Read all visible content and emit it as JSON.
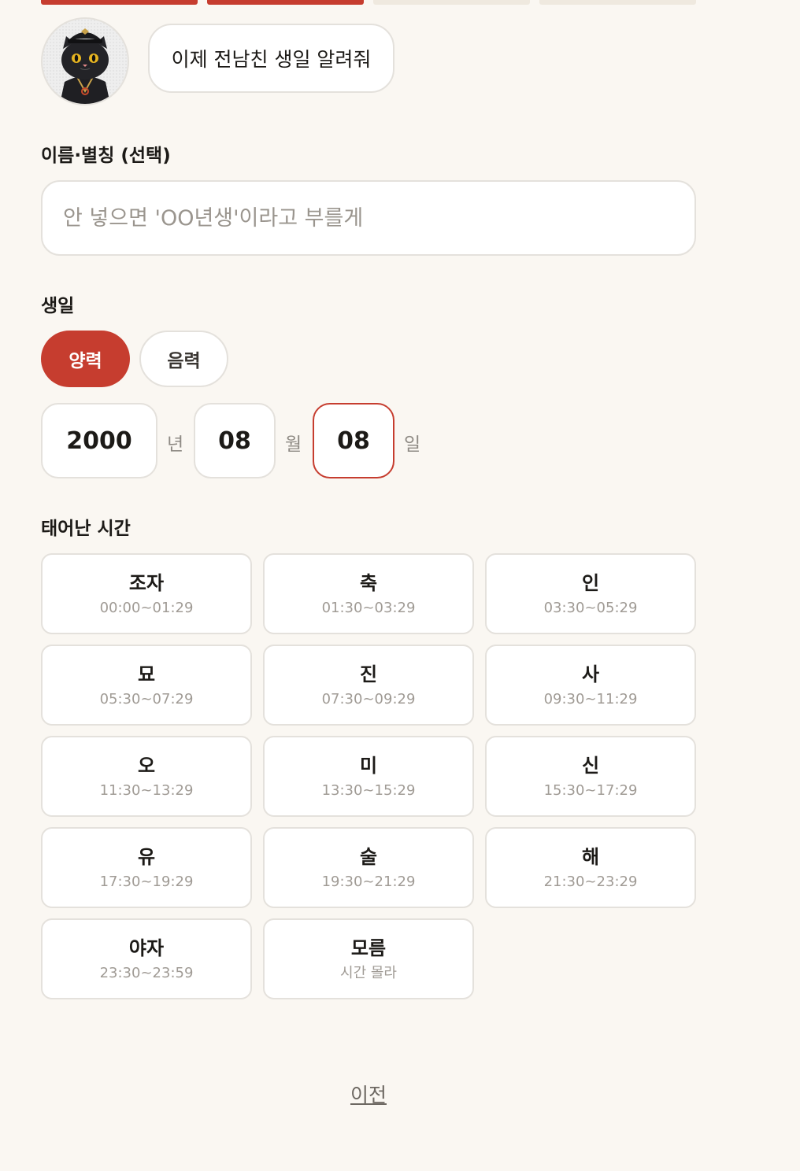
{
  "progress": {
    "total": 4,
    "completed": 2
  },
  "header": {
    "bubble_text": "이제 전남친 생일 알려줘"
  },
  "name_field": {
    "label": "이름·별칭 (선택)",
    "value": "",
    "placeholder": "안 넣으면 'OO년생'이라고 부를게"
  },
  "birthday": {
    "label": "생일",
    "calendar_toggle": {
      "solar": "양력",
      "lunar": "음력",
      "selected": "양력"
    },
    "year": "2000",
    "year_unit": "년",
    "month": "08",
    "month_unit": "월",
    "day": "08",
    "day_unit": "일"
  },
  "birth_time": {
    "label": "태어난 시간",
    "slots": [
      {
        "name": "조자",
        "time": "00:00~01:29"
      },
      {
        "name": "축",
        "time": "01:30~03:29"
      },
      {
        "name": "인",
        "time": "03:30~05:29"
      },
      {
        "name": "묘",
        "time": "05:30~07:29"
      },
      {
        "name": "진",
        "time": "07:30~09:29"
      },
      {
        "name": "사",
        "time": "09:30~11:29"
      },
      {
        "name": "오",
        "time": "11:30~13:29"
      },
      {
        "name": "미",
        "time": "13:30~15:29"
      },
      {
        "name": "신",
        "time": "15:30~17:29"
      },
      {
        "name": "유",
        "time": "17:30~19:29"
      },
      {
        "name": "술",
        "time": "19:30~21:29"
      },
      {
        "name": "해",
        "time": "21:30~23:29"
      },
      {
        "name": "야자",
        "time": "23:30~23:59"
      },
      {
        "name": "모름",
        "time": "시간 몰라"
      }
    ]
  },
  "nav": {
    "prev_label": "이전"
  },
  "colors": {
    "accent": "#c63d2f",
    "background": "#faf7f2",
    "border": "#e4e1dc"
  },
  "icons": {
    "avatar": "black-cat-judge-icon"
  }
}
